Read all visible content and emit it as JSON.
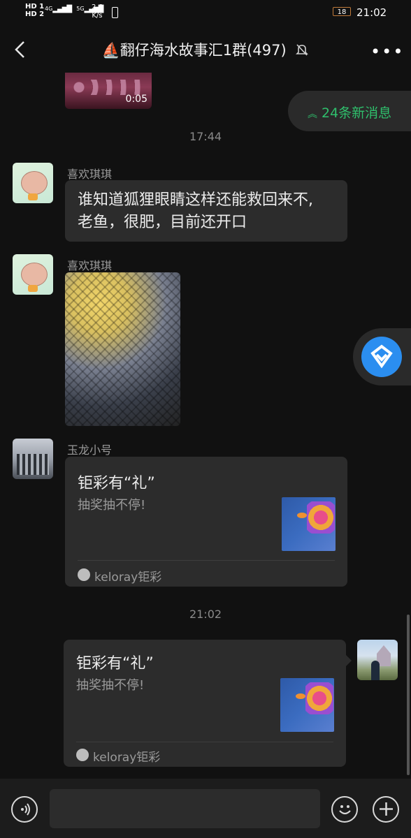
{
  "status": {
    "network_hd1": "HD 1",
    "network_hd2": "HD 2",
    "sig1": "4G",
    "sig2": "5G",
    "speed_value": "2.6",
    "speed_unit": "K/s",
    "battery": "18",
    "time": "21:02"
  },
  "header": {
    "title": "⛵翻仔海水故事汇1群(497)",
    "more": "•••"
  },
  "video": {
    "duration": "0:05"
  },
  "new_messages": {
    "label": "24条新消息"
  },
  "timestamps": {
    "first": "17:44",
    "second": "21:02"
  },
  "messages": [
    {
      "sender": "喜欢琪琪",
      "text_line1": "谁知道狐狸眼睛这样还能救回来不,",
      "text_line2": "老鱼，很肥，目前还开口"
    },
    {
      "sender": "喜欢琪琪"
    },
    {
      "sender": "玉龙小号",
      "card_title": "钜彩有“礼”",
      "card_sub": "抽奖抽不停!",
      "card_source": "keloray钜彩"
    },
    {
      "card_title": "钜彩有“礼”",
      "card_sub": "抽奖抽不停!",
      "card_source": "keloray钜彩"
    }
  ],
  "colors": {
    "accent_green": "#2fbf6c",
    "background": "#111111",
    "bubble": "#2c2c2c",
    "float_blue": "#2b8ef0"
  },
  "icons": {
    "back": "chevron-left-icon",
    "mute": "bell-off-icon",
    "voice": "voice-icon",
    "emoji": "emoji-icon",
    "add": "plus-icon"
  }
}
